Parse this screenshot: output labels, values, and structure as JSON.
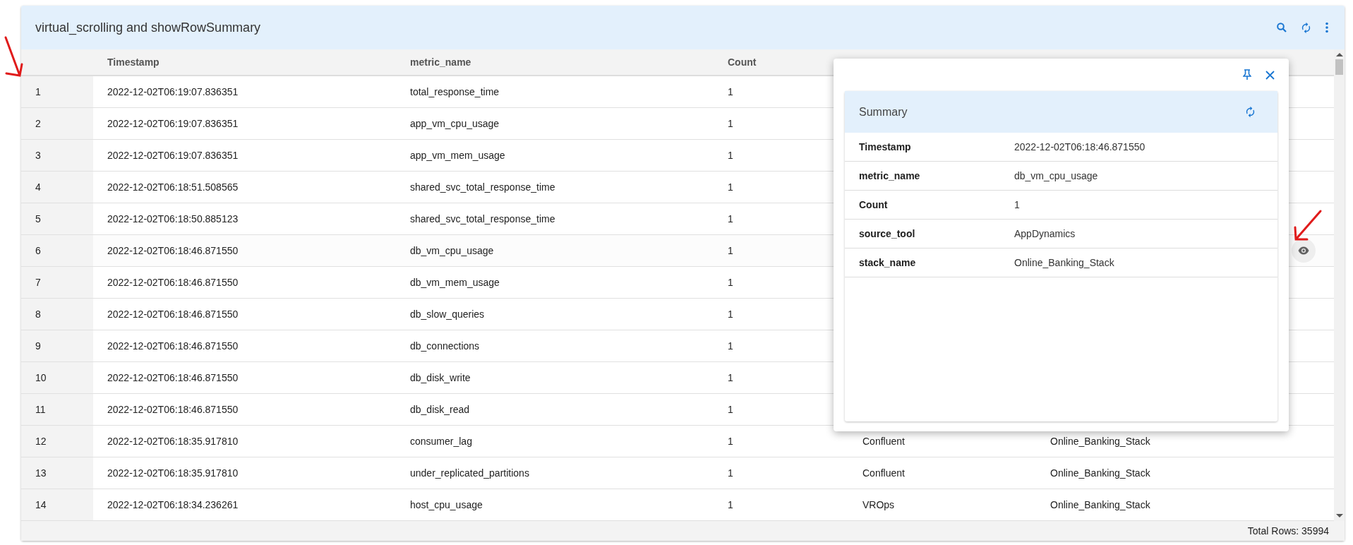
{
  "card": {
    "title": "virtual_scrolling and showRowSummary"
  },
  "table": {
    "columns": [
      {
        "label": "Timestamp"
      },
      {
        "label": "metric_name"
      },
      {
        "label": "Count"
      }
    ],
    "rows": [
      {
        "index": "1",
        "timestamp": "2022-12-02T06:19:07.836351",
        "metric_name": "total_response_time",
        "count": "1",
        "hovered": false
      },
      {
        "index": "2",
        "timestamp": "2022-12-02T06:19:07.836351",
        "metric_name": "app_vm_cpu_usage",
        "count": "1",
        "hovered": false
      },
      {
        "index": "3",
        "timestamp": "2022-12-02T06:19:07.836351",
        "metric_name": "app_vm_mem_usage",
        "count": "1",
        "hovered": false
      },
      {
        "index": "4",
        "timestamp": "2022-12-02T06:18:51.508565",
        "metric_name": "shared_svc_total_response_time",
        "count": "1",
        "hovered": false
      },
      {
        "index": "5",
        "timestamp": "2022-12-02T06:18:50.885123",
        "metric_name": "shared_svc_total_response_time",
        "count": "1",
        "hovered": false
      },
      {
        "index": "6",
        "timestamp": "2022-12-02T06:18:46.871550",
        "metric_name": "db_vm_cpu_usage",
        "count": "1",
        "hovered": true
      },
      {
        "index": "7",
        "timestamp": "2022-12-02T06:18:46.871550",
        "metric_name": "db_vm_mem_usage",
        "count": "1",
        "hovered": false
      },
      {
        "index": "8",
        "timestamp": "2022-12-02T06:18:46.871550",
        "metric_name": "db_slow_queries",
        "count": "1",
        "hovered": false
      },
      {
        "index": "9",
        "timestamp": "2022-12-02T06:18:46.871550",
        "metric_name": "db_connections",
        "count": "1",
        "hovered": false
      },
      {
        "index": "10",
        "timestamp": "2022-12-02T06:18:46.871550",
        "metric_name": "db_disk_write",
        "count": "1",
        "hovered": false
      },
      {
        "index": "11",
        "timestamp": "2022-12-02T06:18:46.871550",
        "metric_name": "db_disk_read",
        "count": "1",
        "hovered": false
      },
      {
        "index": "12",
        "timestamp": "2022-12-02T06:18:35.917810",
        "metric_name": "consumer_lag",
        "count": "1",
        "source_tool": "Confluent",
        "stack_name": "Online_Banking_Stack",
        "hovered": false
      },
      {
        "index": "13",
        "timestamp": "2022-12-02T06:18:35.917810",
        "metric_name": "under_replicated_partitions",
        "count": "1",
        "source_tool": "Confluent",
        "stack_name": "Online_Banking_Stack",
        "hovered": false
      },
      {
        "index": "14",
        "timestamp": "2022-12-02T06:18:34.236261",
        "metric_name": "host_cpu_usage",
        "count": "1",
        "source_tool": "VROps",
        "stack_name": "Online_Banking_Stack",
        "hovered": false
      }
    ],
    "footer": "Total Rows: 35994"
  },
  "summary_popup": {
    "title": "Summary",
    "fields": [
      {
        "label": "Timestamp",
        "value": "2022-12-02T06:18:46.871550"
      },
      {
        "label": "metric_name",
        "value": "db_vm_cpu_usage"
      },
      {
        "label": "Count",
        "value": "1"
      },
      {
        "label": "source_tool",
        "value": "AppDynamics"
      },
      {
        "label": "stack_name",
        "value": "Online_Banking_Stack"
      }
    ]
  }
}
